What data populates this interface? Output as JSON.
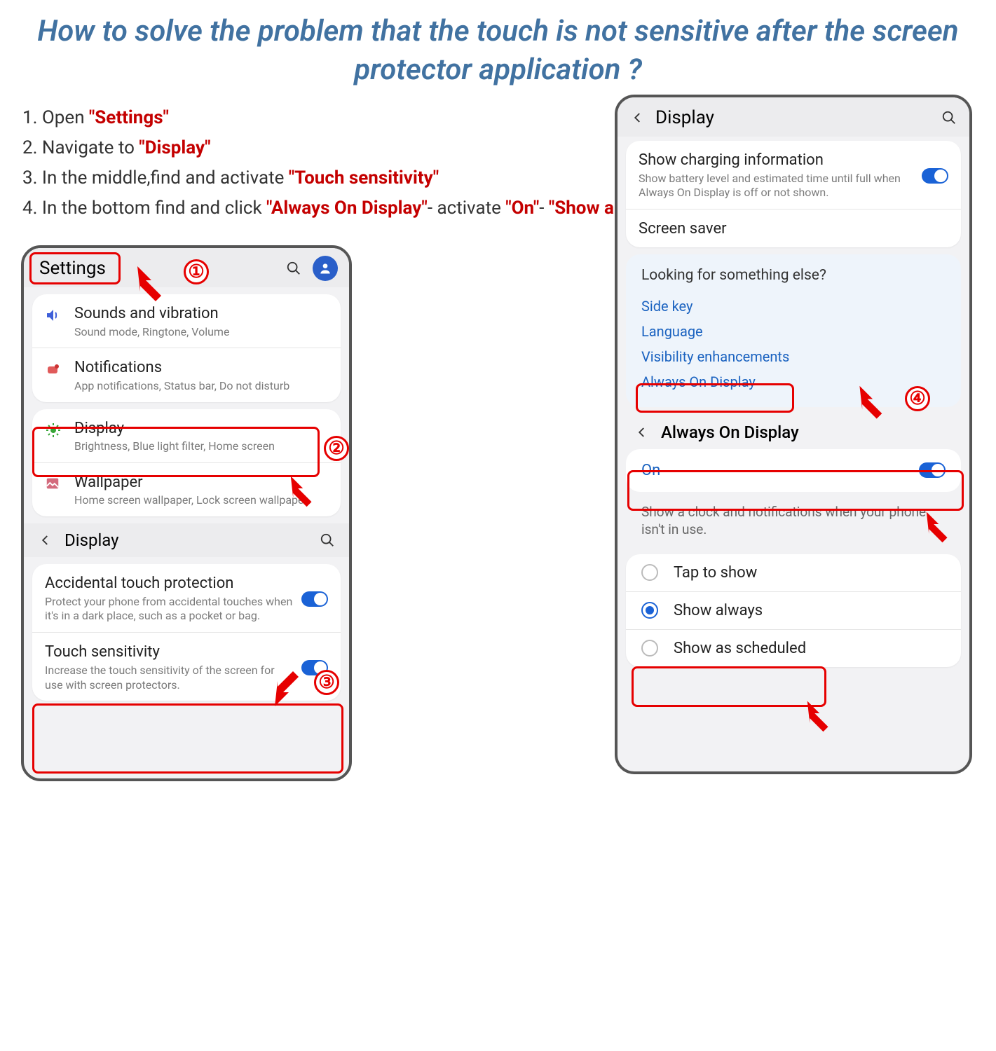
{
  "title": "How to solve the problem that the touch is not sensitive after  the screen protector application ?",
  "step1_p": "1. Open ",
  "step1_r": "\"Settings\"",
  "step2_p": "2. Navigate to ",
  "step2_r": "\"Display\"",
  "step3_p": "3. In the middle,find and activate ",
  "step3_r": "\"Touch sensitivity\"",
  "step4_p": "4. In the bottom find and click ",
  "step4_r1": "\"Always On Display\"",
  "step4_m": "- activate ",
  "step4_r2": "\"On\"",
  "step4_m2": "- ",
  "step4_r3": "\"Show always\"",
  "b1": "①",
  "b2": "②",
  "b3": "③",
  "b4": "④",
  "left": {
    "settings": "Settings",
    "r1_t": "Sounds and vibration",
    "r1_s": "Sound mode, Ringtone, Volume",
    "r2_t": "Notifications",
    "r2_s": "App notifications, Status bar, Do not disturb",
    "r3_t": "Display",
    "r3_s": "Brightness, Blue light filter, Home screen",
    "r4_t": "Wallpaper",
    "r4_s": "Home screen wallpaper, Lock screen wallpaper",
    "display": "Display",
    "r5_t": "Accidental touch protection",
    "r5_s": "Protect your phone from accidental touches when it's in a dark place, such as a pocket or bag.",
    "r6_t": "Touch sensitivity",
    "r6_s": "Increase the touch sensitivity of the screen for use with screen protectors."
  },
  "right": {
    "display": "Display",
    "r1_t": "Show charging information",
    "r1_s": "Show battery level and estimated time until full when Always On Display is off or not shown.",
    "r2_t": "Screen saver",
    "sec_title": "Looking for something else?",
    "l1": "Side key",
    "l2": "Language",
    "l3": "Visibility enhancements",
    "l4": "Always On Display",
    "aod": "Always On Display",
    "on": "On",
    "desc": "Show a clock and notifications when your phone isn't in use.",
    "o1": "Tap to show",
    "o2": "Show always",
    "o3": "Show as scheduled"
  }
}
